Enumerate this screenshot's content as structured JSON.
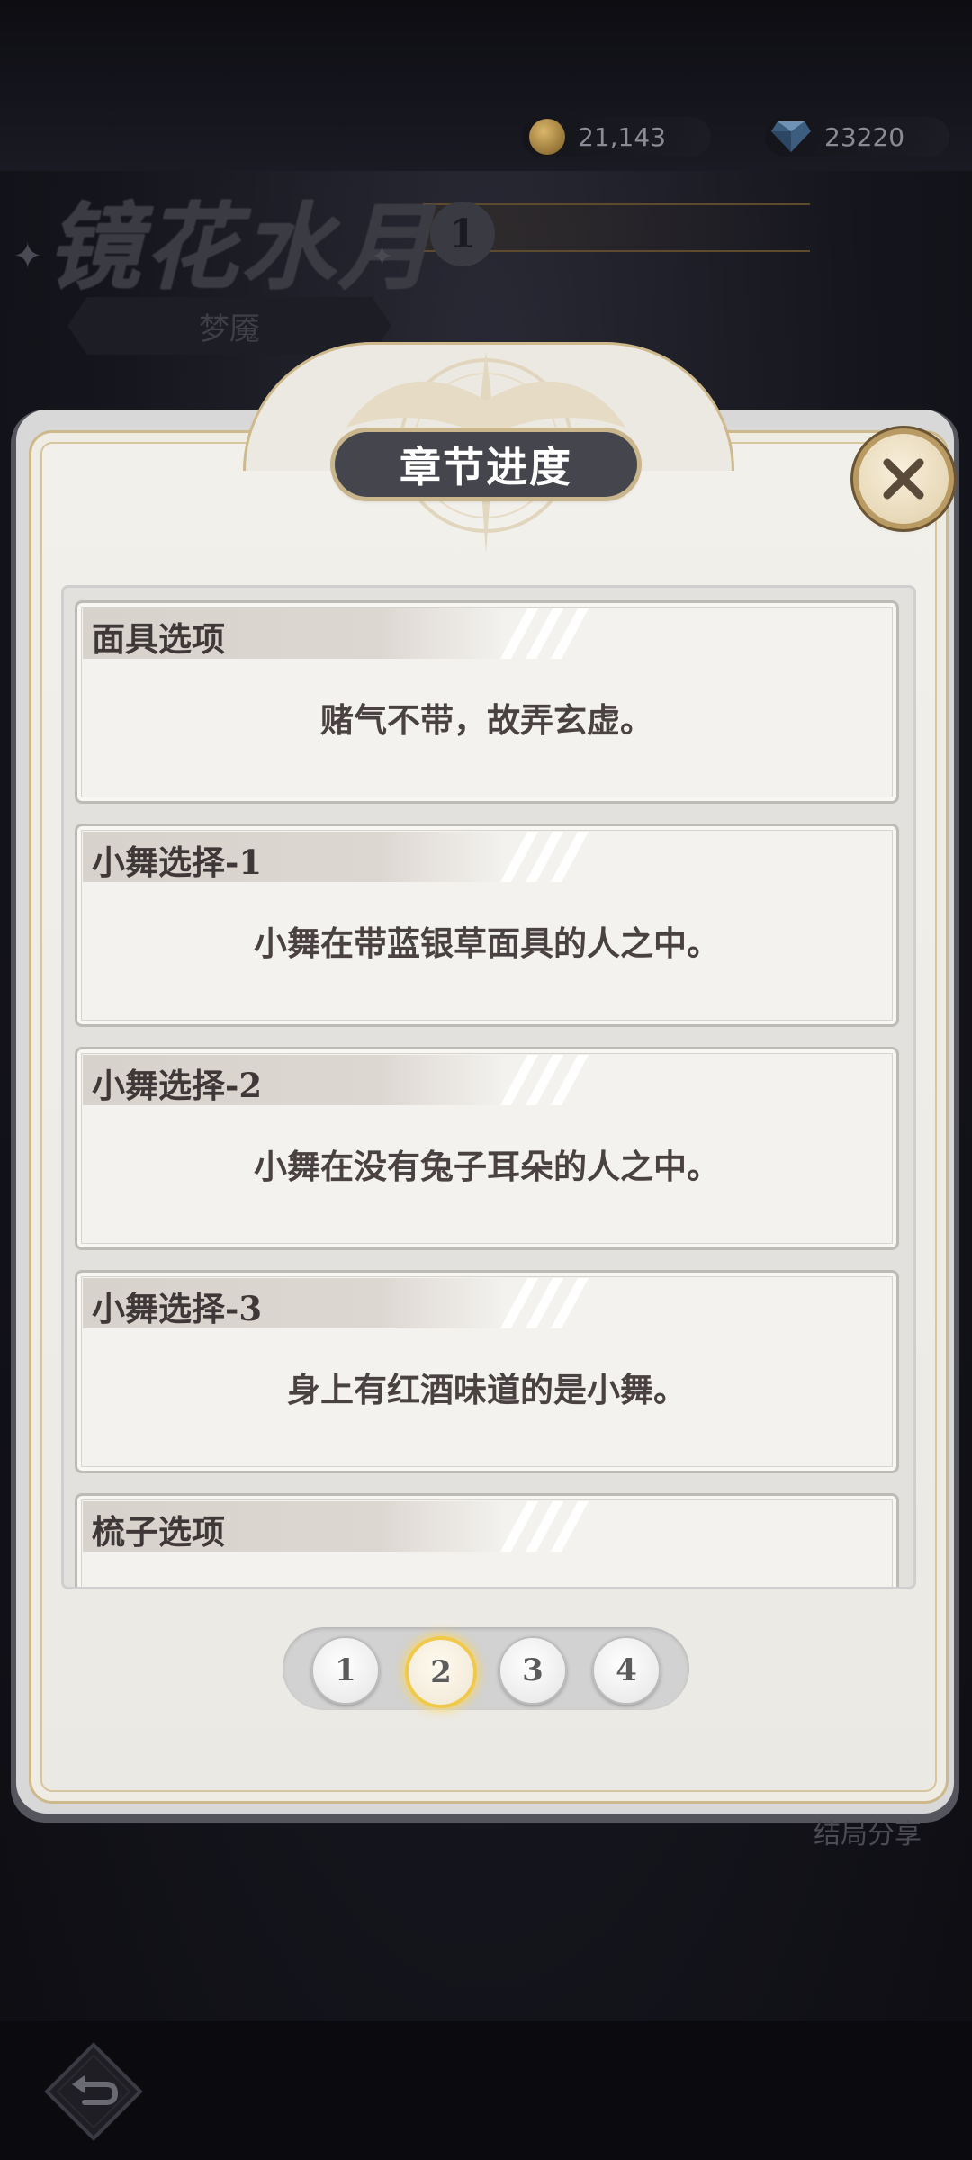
{
  "currency": {
    "coins": "21,143",
    "coins_icon": "coin-icon",
    "gems": "23220",
    "gems_icon": "diamond-icon"
  },
  "header": {
    "title": "镜花水月",
    "badge": "1",
    "subtitle": "梦魇"
  },
  "panel": {
    "title": "章节进度",
    "close_icon": "close-icon",
    "items": [
      {
        "label": "面具选项",
        "text": "赌气不带，故弄玄虚。"
      },
      {
        "label": "小舞选择-1",
        "text": "小舞在带蓝银草面具的人之中。"
      },
      {
        "label": "小舞选择-2",
        "text": "小舞在没有兔子耳朵的人之中。"
      },
      {
        "label": "小舞选择-3",
        "text": "身上有红酒味道的是小舞。"
      },
      {
        "label": "梳子选项",
        "text": ""
      }
    ]
  },
  "pager": {
    "pages": [
      "1",
      "2",
      "3",
      "4"
    ],
    "current": "2"
  },
  "footer": {
    "share": "结局分享",
    "back_icon": "back-arrow-icon"
  },
  "colors": {
    "panel_bg": "#f2f0ea",
    "gold_accent": "#cdb98c",
    "active_page": "#f1c94a",
    "title_pill": "#45454d"
  }
}
